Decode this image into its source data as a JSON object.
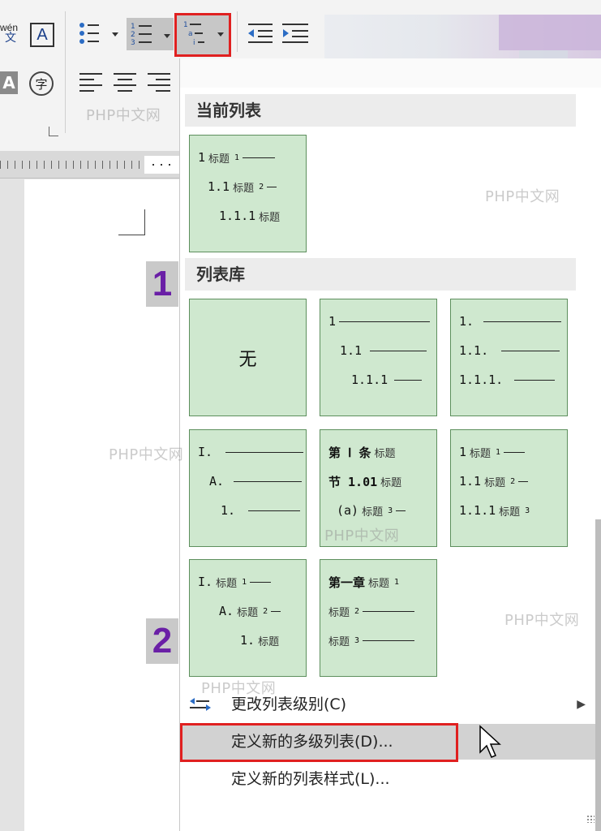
{
  "ribbon": {
    "pinyin_top": "wén",
    "pinyin_char": "文",
    "font_box_letter": "A",
    "char_shading_letter": "A",
    "enclose_char": "字",
    "bullets_icon": "bullet-list-icon",
    "numbering_icon": "numbered-list-icon",
    "multilevel_icon": "multilevel-list-icon",
    "decrease_indent_icon": "decrease-indent-icon",
    "increase_indent_icon": "increase-indent-icon"
  },
  "steps": {
    "step1": "1",
    "step2": "2"
  },
  "dropdown": {
    "current_list_header": "当前列表",
    "current_list": [
      {
        "num": "1",
        "label": "标题",
        "level": "1"
      },
      {
        "num": "1.1",
        "label": "标题",
        "level": "2"
      },
      {
        "num": "1.1.1",
        "label": "标题"
      }
    ],
    "library_header": "列表库",
    "library": {
      "none_label": "无",
      "tile2": [
        "1",
        "1.1",
        "1.1.1"
      ],
      "tile3": [
        "1.",
        "1.1.",
        "1.1.1."
      ],
      "tile4": [
        "I.",
        "A.",
        "1."
      ],
      "tile5": [
        {
          "num": "第 Ⅰ 条",
          "label": "标题"
        },
        {
          "num": "节 1.01",
          "label": "标题"
        },
        {
          "num": "(a)",
          "label": "标题",
          "level": "3"
        }
      ],
      "tile6": [
        {
          "num": "1",
          "label": "标题",
          "level": "1"
        },
        {
          "num": "1.1",
          "label": "标题",
          "level": "2"
        },
        {
          "num": "1.1.1",
          "label": "标题",
          "level": "3"
        }
      ],
      "tile7": [
        {
          "num": "I.",
          "label": "标题",
          "level": "1"
        },
        {
          "num": "A.",
          "label": "标题",
          "level": "2"
        },
        {
          "num": "1.",
          "label": "标题"
        }
      ],
      "tile8": [
        {
          "num": "第一章",
          "label": "标题",
          "level": "1"
        },
        {
          "num": "",
          "label": "标题",
          "level": "2"
        },
        {
          "num": "",
          "label": "标题",
          "level": "3"
        }
      ]
    },
    "menu": {
      "change_level": "更改列表级别(C)",
      "define_multilevel": "定义新的多级列表(D)...",
      "define_style": "定义新的列表样式(L)..."
    }
  },
  "watermark": "PHP中文网",
  "colors": {
    "highlight_red": "#e02020",
    "tile_green": "#cfe8cf",
    "step_purple": "#6a1fa6"
  }
}
